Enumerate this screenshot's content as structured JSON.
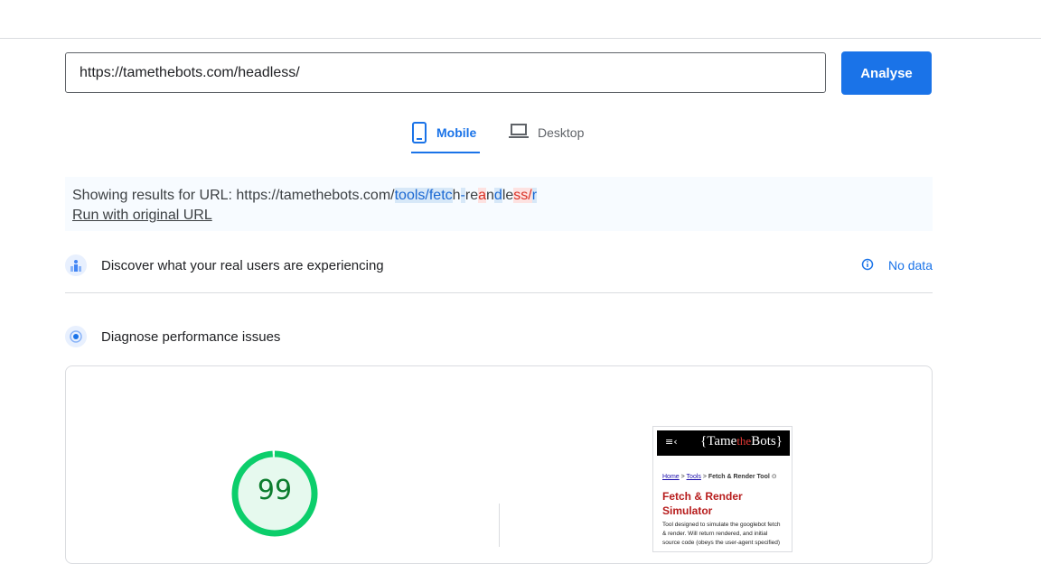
{
  "search": {
    "url_value": "https://tamethebots.com/headless/",
    "analyse_label": "Analyse"
  },
  "tabs": [
    {
      "label": "Mobile",
      "active": true
    },
    {
      "label": "Desktop",
      "active": false
    }
  ],
  "info": {
    "prefix": "Showing results for URL: https://tamethebots.com/",
    "url_parts": [
      "tools/fetc",
      "h",
      "-",
      "re",
      "a",
      "n",
      "d",
      "le",
      "ss/",
      "r"
    ],
    "run_link": "Run with original URL"
  },
  "field_data": {
    "title": "Discover what your real users are experiencing",
    "status": "No data"
  },
  "lab": {
    "title": "Diagnose performance issues",
    "score": 99,
    "score_color": "#0cce6b"
  },
  "thumbnail": {
    "menu_glyph": "≡‹",
    "logo_open": "{Tame",
    "logo_the": "the",
    "logo_close": "Bots}",
    "crumb_home": "Home",
    "crumb_sep": " > ",
    "crumb_tools": "Tools",
    "crumb_current": "Fetch & Render Tool",
    "title": "Fetch & Render Simulator",
    "description": "Tool designed to simulate the googlebot fetch & render. Will return rendered, and initial source code (obeys the user-agent specified)"
  },
  "colors": {
    "accent": "#1a73e8",
    "pass": "#0cce6b"
  }
}
